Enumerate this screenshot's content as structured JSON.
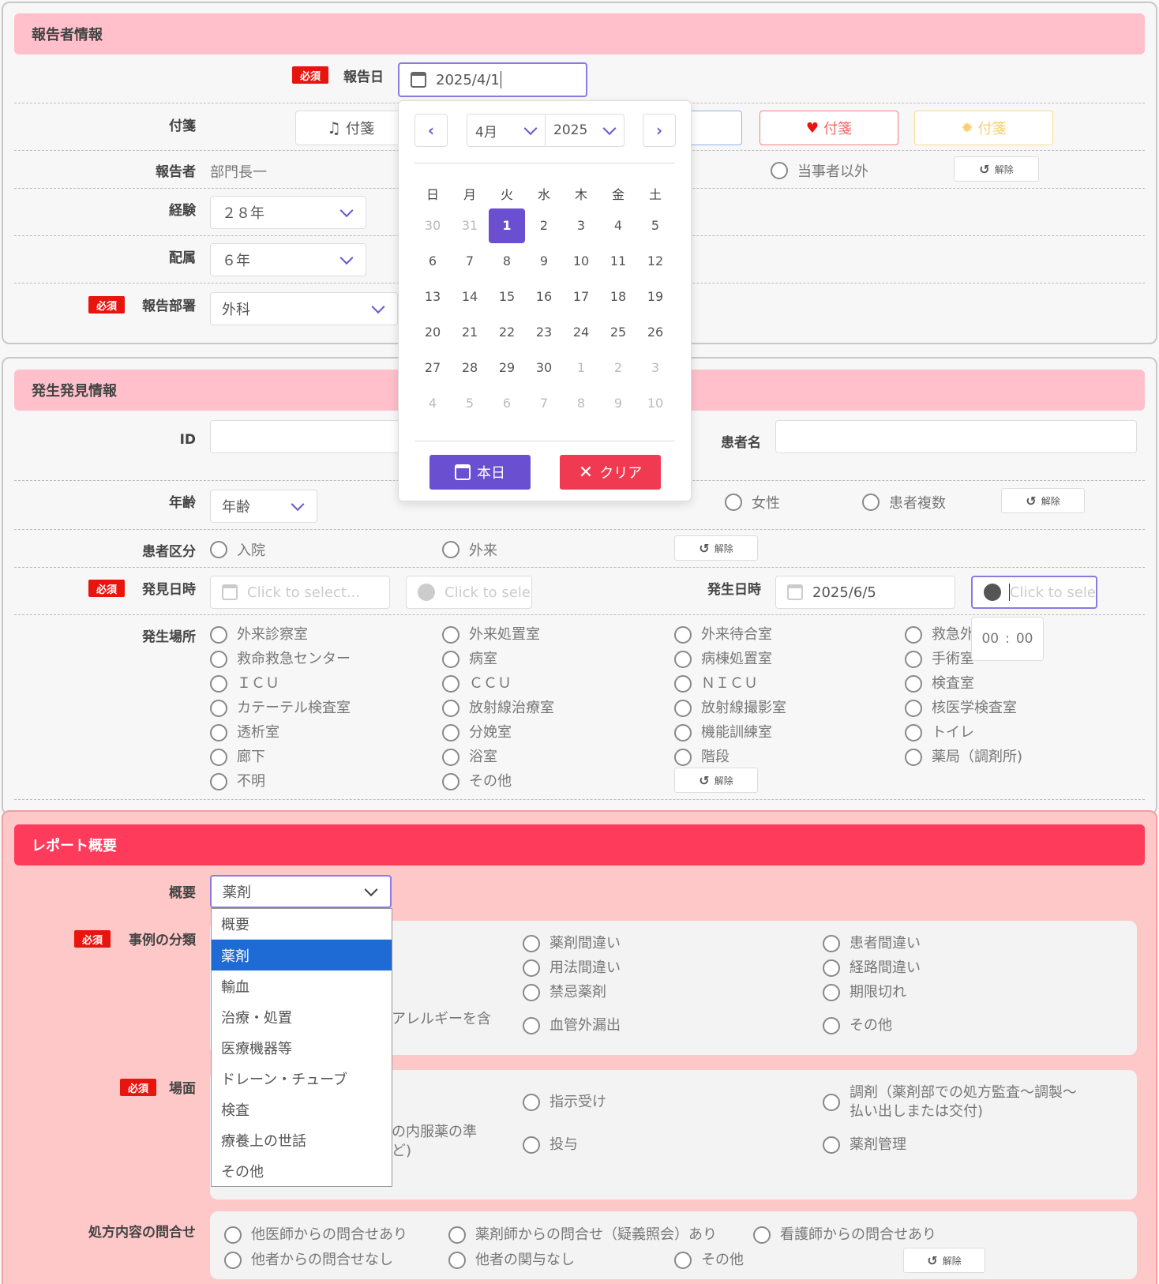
{
  "section1": {
    "title": "報告者情報",
    "required_label": "必須",
    "report_date": {
      "label": "報告日",
      "value": "2025/4/1"
    },
    "tags": {
      "label": "付箋",
      "buttons": [
        "付箋",
        "付箋",
        "付箋",
        "付箋"
      ]
    },
    "reporter": {
      "label": "報告者",
      "value": "部門長一",
      "option_other": "当事者以外",
      "clear": "解除"
    },
    "experience": {
      "label": "経験",
      "value": "２８年"
    },
    "assignment": {
      "label": "配属",
      "value": "６年"
    },
    "department": {
      "label": "報告部署",
      "value": "外科"
    }
  },
  "calendar": {
    "month": "4月",
    "year": "2025",
    "weekdays": [
      "日",
      "月",
      "火",
      "水",
      "木",
      "金",
      "土"
    ],
    "weeks": [
      [
        "30",
        "31",
        "1",
        "2",
        "3",
        "4",
        "5"
      ],
      [
        "6",
        "7",
        "8",
        "9",
        "10",
        "11",
        "12"
      ],
      [
        "13",
        "14",
        "15",
        "16",
        "17",
        "18",
        "19"
      ],
      [
        "20",
        "21",
        "22",
        "23",
        "24",
        "25",
        "26"
      ],
      [
        "27",
        "28",
        "29",
        "30",
        "1",
        "2",
        "3"
      ],
      [
        "4",
        "5",
        "6",
        "7",
        "8",
        "9",
        "10"
      ]
    ],
    "today_button": "本日",
    "clear_button": "クリア"
  },
  "section2": {
    "title": "発生発見情報",
    "id_label": "ID",
    "patient_name_label": "患者名",
    "age": {
      "label": "年齢",
      "placeholder": "年齢"
    },
    "gender_options": [
      "女性",
      "患者複数"
    ],
    "clear": "解除",
    "patient_type": {
      "label": "患者区分",
      "options": [
        "入院",
        "外来"
      ]
    },
    "discovery": {
      "label": "発見日時",
      "date_placeholder": "Click to select...",
      "time_placeholder": "Click to selec"
    },
    "occurrence": {
      "label": "発生日時",
      "date_value": "2025/6/5",
      "time_placeholder": "Click to selec",
      "hour": "00",
      "minute": "00"
    },
    "location": {
      "label": "発生場所",
      "col1": [
        "外来診察室",
        "救命救急センター",
        "ＩＣＵ",
        "カテーテル検査室",
        "透析室",
        "廊下",
        "不明"
      ],
      "col2": [
        "外来処置室",
        "病室",
        "ＣＣＵ",
        "放射線治療室",
        "分娩室",
        "浴室",
        "その他"
      ],
      "col3": [
        "外来待合室",
        "病棟処置室",
        "ＮＩＣＵ",
        "放射線撮影室",
        "機能訓練室",
        "階段"
      ],
      "col4": [
        "救急外",
        "手術室",
        "検査室",
        "核医学検査室",
        "トイレ",
        "薬局（調剤所)"
      ]
    }
  },
  "section3": {
    "title": "レポート概要",
    "summary": {
      "label": "概要",
      "value": "薬剤"
    },
    "dropdown_options": [
      "概要",
      "薬剤",
      "輸血",
      "治療・処置",
      "医療機器等",
      "ドレーン・チューブ",
      "検査",
      "療養上の世話",
      "その他"
    ],
    "case_class": {
      "label": "事例の分類",
      "partial": "アレルギーを含",
      "col2": [
        "薬剤間違い",
        "用法間違い",
        "禁忌薬剤",
        "血管外漏出"
      ],
      "col3": [
        "患者間違い",
        "経路間違い",
        "期限切れ",
        "その他"
      ]
    },
    "scene": {
      "label": "場面",
      "partial": "の内服薬の準\nど)",
      "col2": [
        "指示受け",
        "投与"
      ],
      "col3": [
        "調剤（薬剤部での処方監査～調製～\n払い出しまたは交付)",
        "薬剤管理"
      ]
    },
    "inquiry": {
      "label": "処方内容の問合せ",
      "row1": [
        "他医師からの問合せあり",
        "薬剤師からの問合せ（疑義照会）あり",
        "看護師からの問合せあり"
      ],
      "row2": [
        "他者からの問合せなし",
        "他者の関与なし",
        "その他"
      ],
      "clear": "解除"
    }
  },
  "colors": {
    "accent": "#6a4fd0",
    "required": "#e8150e",
    "section_pink": "#ffc0cb",
    "section_red": "#ff3b5c",
    "dropdown_highlight": "#1e6bd6"
  }
}
